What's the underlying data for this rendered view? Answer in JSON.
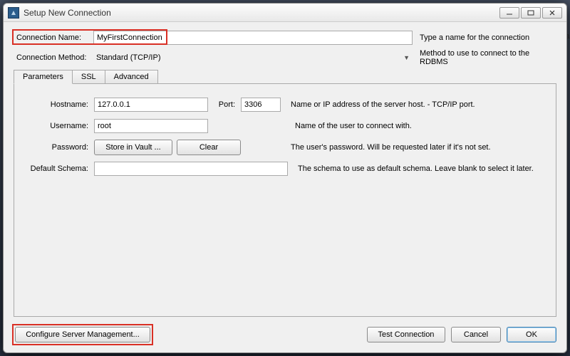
{
  "window": {
    "title": "Setup New Connection"
  },
  "fields": {
    "connection_name": {
      "label": "Connection Name:",
      "value": "MyFirstConnection",
      "help": "Type a name for the connection"
    },
    "connection_method": {
      "label": "Connection Method:",
      "value": "Standard (TCP/IP)",
      "help": "Method to use to connect to the RDBMS"
    }
  },
  "tabs": {
    "parameters": "Parameters",
    "ssl": "SSL",
    "advanced": "Advanced"
  },
  "params": {
    "hostname": {
      "label": "Hostname:",
      "value": "127.0.0.1",
      "help": "Name or IP address of the server host. - TCP/IP port."
    },
    "port": {
      "label": "Port:",
      "value": "3306"
    },
    "username": {
      "label": "Username:",
      "value": "root",
      "help": "Name of the user to connect with."
    },
    "password": {
      "label": "Password:",
      "store_button": "Store in Vault ...",
      "clear_button": "Clear",
      "help": "The user's password. Will be requested later if it's not set."
    },
    "default_schema": {
      "label": "Default Schema:",
      "value": "",
      "help": "The schema to use as default schema. Leave blank to select it later."
    }
  },
  "footer": {
    "configure": "Configure Server Management...",
    "test": "Test Connection",
    "cancel": "Cancel",
    "ok": "OK"
  }
}
